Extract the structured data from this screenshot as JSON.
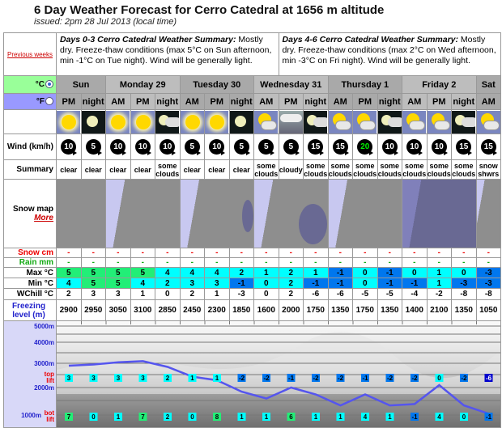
{
  "header": {
    "title": "6 Day Weather Forecast for Cerro Catedral at 1656 m altitude",
    "issued": "issued: 2pm 28 Jul 2013 (local time)"
  },
  "previous_weeks": "Previous weeks",
  "summary": [
    {
      "heading": "Days 0-3 Cerro Catedral Weather Summary:",
      "text": " Mostly dry. Freeze-thaw conditions (max 5°C on Sun afternoon, min -1°C on Tue night). Wind will be generally light."
    },
    {
      "heading": "Days 4-6 Cerro Catedral Weather Summary:",
      "text": " Mostly dry. Freeze-thaw conditions (max 2°C on Wed afternoon, min -3°C on Fri night). Wind will be generally light."
    }
  ],
  "units": {
    "celsius": "°C",
    "fahrenheit": "°F",
    "selected": "celsius"
  },
  "days": [
    {
      "label": "Sun",
      "span": 2
    },
    {
      "label": "Monday 29",
      "span": 3
    },
    {
      "label": "Tuesday 30",
      "span": 3
    },
    {
      "label": "Wednesday 31",
      "span": 3
    },
    {
      "label": "Thursday 1",
      "span": 3
    },
    {
      "label": "Friday 2",
      "span": 3
    },
    {
      "label": "Sat",
      "span": 1
    }
  ],
  "periods": [
    "PM",
    "night",
    "AM",
    "PM",
    "night",
    "AM",
    "PM",
    "night",
    "AM",
    "PM",
    "night",
    "AM",
    "PM",
    "night",
    "AM",
    "PM",
    "night",
    "AM"
  ],
  "icons": [
    "sun",
    "moon",
    "sun",
    "sun",
    "moon-cloud",
    "sun",
    "sun",
    "moon",
    "sun-cloud",
    "cloudy",
    "moon-cloud",
    "sun-cloud",
    "sun-cloud",
    "moon-cloud",
    "sun-cloud",
    "sun-cloud",
    "moon-cloud",
    "snow-shower"
  ],
  "labels": {
    "wind": "Wind (km/h)",
    "summary": "Summary",
    "snow_map": "Snow map",
    "more": "More",
    "snow": "Snow cm",
    "rain": "Rain mm",
    "max": "Max °C",
    "min": "Min °C",
    "wchill": "WChill °C",
    "freezing1": "Freezing",
    "freezing2": "level (m)",
    "top_lift1": "top",
    "top_lift2": "lift",
    "bot_lift1": "bot",
    "bot_lift2": "lift"
  },
  "wind": [
    10,
    5,
    10,
    10,
    10,
    5,
    10,
    5,
    5,
    5,
    15,
    15,
    20,
    10,
    10,
    10,
    15,
    15
  ],
  "wind_highlight_color": "#00ee00",
  "conditions": [
    "clear",
    "clear",
    "clear",
    "clear",
    "some clouds",
    "clear",
    "clear",
    "clear",
    "some clouds",
    "cloudy",
    "some clouds",
    "some clouds",
    "some clouds",
    "some clouds",
    "some clouds",
    "some clouds",
    "some clouds",
    "snow shwrs"
  ],
  "snow": [
    "-",
    "-",
    "-",
    "-",
    "-",
    "-",
    "-",
    "-",
    "-",
    "-",
    "-",
    "-",
    "-",
    "-",
    "-",
    "-",
    "-",
    "-"
  ],
  "rain": [
    "-",
    "-",
    "-",
    "-",
    "-",
    "-",
    "-",
    "-",
    "-",
    "-",
    "-",
    "-",
    "-",
    "-",
    "-",
    "-",
    "-",
    "-"
  ],
  "max": [
    5,
    5,
    5,
    5,
    4,
    4,
    4,
    2,
    1,
    2,
    1,
    -1,
    0,
    -1,
    0,
    1,
    0,
    -3
  ],
  "min": [
    4,
    5,
    5,
    4,
    2,
    3,
    3,
    -1,
    0,
    2,
    -1,
    -1,
    0,
    -1,
    -1,
    1,
    -3,
    -3
  ],
  "wchill": [
    2,
    3,
    3,
    1,
    0,
    2,
    1,
    -3,
    0,
    2,
    -6,
    -6,
    -5,
    -5,
    -4,
    -2,
    -8,
    -8
  ],
  "freezing": [
    2900,
    2950,
    3050,
    3100,
    2850,
    2450,
    2300,
    1850,
    1600,
    2000,
    1750,
    1350,
    1750,
    1350,
    1400,
    2100,
    1350,
    1050
  ],
  "chart": {
    "y_labels": [
      "5000m",
      "4000m",
      "3000m",
      "2000m",
      "1000m"
    ],
    "top_lift": [
      3,
      3,
      3,
      3,
      2,
      1,
      1,
      -2,
      -2,
      -1,
      -2,
      -2,
      -1,
      -2,
      -2,
      0,
      -2,
      -6
    ],
    "bot_lift": [
      7,
      0,
      1,
      7,
      2,
      0,
      8,
      1,
      1,
      6,
      1,
      1,
      4,
      1,
      -1,
      4,
      0,
      -1
    ],
    "line_color": "#5555ee"
  },
  "colors": {
    "warm": "#22ee77",
    "mild": "#00ffff",
    "cold": "#0077ee",
    "very_cold": "#0000cc"
  }
}
